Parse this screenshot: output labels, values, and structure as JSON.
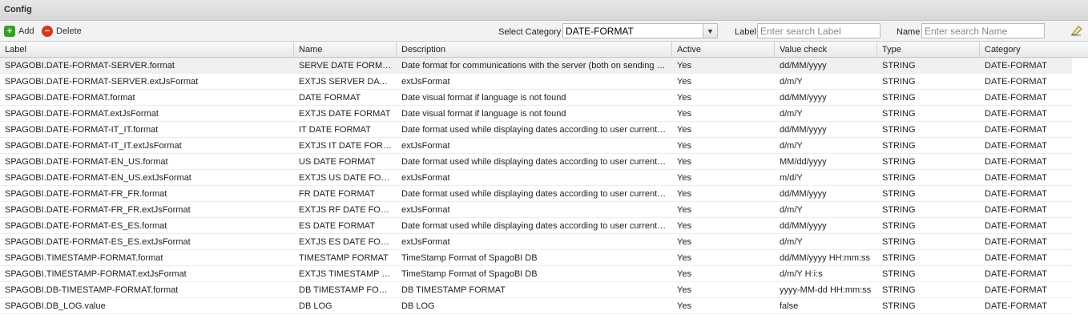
{
  "title": "Config",
  "toolbar": {
    "add_label": "Add",
    "delete_label": "Delete",
    "select_category_label": "Select Category",
    "category_value": "DATE-FORMAT",
    "label_label": "Label",
    "label_placeholder": "Enter search Label",
    "name_label": "Name",
    "name_placeholder": "Enter search Name"
  },
  "grid": {
    "columns": [
      "Label",
      "Name",
      "Description",
      "Active",
      "Value check",
      "Type",
      "Category"
    ],
    "rows": [
      [
        "SPAGOBI.DATE-FORMAT-SERVER.format",
        "SERVE DATE FORMAT",
        "Date format for communications with the server (both on sending and receiving)",
        "Yes",
        "dd/MM/yyyy",
        "STRING",
        "DATE-FORMAT"
      ],
      [
        "SPAGOBI.DATE-FORMAT-SERVER.extJsFormat",
        "EXTJS SERVER DATE FORMAT",
        "extJsFormat",
        "Yes",
        "d/m/Y",
        "STRING",
        "DATE-FORMAT"
      ],
      [
        "SPAGOBI.DATE-FORMAT.format",
        "DATE FORMAT",
        "Date visual format if language is not found",
        "Yes",
        "dd/MM/yyyy",
        "STRING",
        "DATE-FORMAT"
      ],
      [
        "SPAGOBI.DATE-FORMAT.extJsFormat",
        "EXTJS DATE FORMAT",
        "Date visual format if language is not found",
        "Yes",
        "d/m/Y",
        "STRING",
        "DATE-FORMAT"
      ],
      [
        "SPAGOBI.DATE-FORMAT-IT_IT.format",
        "IT DATE FORMAT",
        "Date format used while displaying dates according to user current locale",
        "Yes",
        "dd/MM/yyyy",
        "STRING",
        "DATE-FORMAT"
      ],
      [
        "SPAGOBI.DATE-FORMAT-IT_IT.extJsFormat",
        "EXTJS IT DATE FORMAT",
        "extJsFormat",
        "Yes",
        "d/m/Y",
        "STRING",
        "DATE-FORMAT"
      ],
      [
        "SPAGOBI.DATE-FORMAT-EN_US.format",
        "US DATE FORMAT",
        "Date format used while displaying dates according to user current locale",
        "Yes",
        "MM/dd/yyyy",
        "STRING",
        "DATE-FORMAT"
      ],
      [
        "SPAGOBI.DATE-FORMAT-EN_US.extJsFormat",
        "EXTJS US DATE FORMAT",
        "extJsFormat",
        "Yes",
        "m/d/Y",
        "STRING",
        "DATE-FORMAT"
      ],
      [
        "SPAGOBI.DATE-FORMAT-FR_FR.format",
        "FR DATE FORMAT",
        "Date format used while displaying dates according to user current locale",
        "Yes",
        "dd/MM/yyyy",
        "STRING",
        "DATE-FORMAT"
      ],
      [
        "SPAGOBI.DATE-FORMAT-FR_FR.extJsFormat",
        "EXTJS RF DATE FORMAT",
        "extJsFormat",
        "Yes",
        "d/m/Y",
        "STRING",
        "DATE-FORMAT"
      ],
      [
        "SPAGOBI.DATE-FORMAT-ES_ES.format",
        "ES DATE FORMAT",
        "Date format used while displaying dates according to user current locale",
        "Yes",
        "dd/MM/yyyy",
        "STRING",
        "DATE-FORMAT"
      ],
      [
        "SPAGOBI.DATE-FORMAT-ES_ES.extJsFormat",
        "EXTJS ES DATE FORMAT",
        "extJsFormat",
        "Yes",
        "d/m/Y",
        "STRING",
        "DATE-FORMAT"
      ],
      [
        "SPAGOBI.TIMESTAMP-FORMAT.format",
        "TIMESTAMP FORMAT",
        "TimeStamp Format of SpagoBI DB",
        "Yes",
        "dd/MM/yyyy HH:mm:ss",
        "STRING",
        "DATE-FORMAT"
      ],
      [
        "SPAGOBI.TIMESTAMP-FORMAT.extJsFormat",
        "EXTJS TIMESTAMP FORMAT",
        "TimeStamp Format of SpagoBI DB",
        "Yes",
        "d/m/Y H:i:s",
        "STRING",
        "DATE-FORMAT"
      ],
      [
        "SPAGOBI.DB-TIMESTAMP-FORMAT.format",
        "DB TIMESTAMP FORMAT",
        "DB TIMESTAMP FORMAT",
        "Yes",
        "yyyy-MM-dd HH:mm:ss",
        "STRING",
        "DATE-FORMAT"
      ],
      [
        "SPAGOBI.DB_LOG.value",
        "DB LOG",
        "DB LOG",
        "Yes",
        "false",
        "STRING",
        "DATE-FORMAT"
      ]
    ]
  }
}
